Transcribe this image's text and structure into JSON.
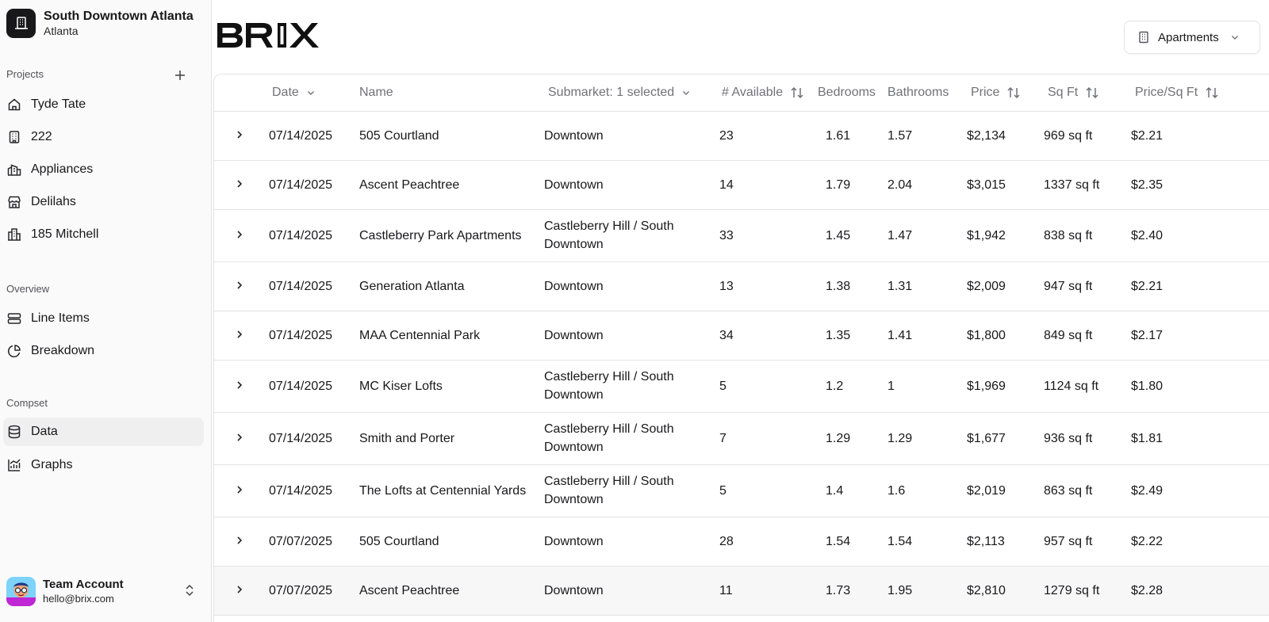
{
  "workspace": {
    "title": "South Downtown Atlanta",
    "subtitle": "Atlanta"
  },
  "sidebar": {
    "projects_label": "Projects",
    "projects": [
      {
        "label": "Tyde Tate",
        "icon": "home-icon"
      },
      {
        "label": "222",
        "icon": "building-icon"
      },
      {
        "label": "Appliances",
        "icon": "buildings-icon"
      },
      {
        "label": "Delilahs",
        "icon": "store-icon"
      },
      {
        "label": "185 Mitchell",
        "icon": "city-icon"
      }
    ],
    "overview_label": "Overview",
    "overview": [
      {
        "label": "Line Items",
        "icon": "layers-icon"
      },
      {
        "label": "Breakdown",
        "icon": "pie-chart-icon"
      }
    ],
    "compset_label": "Compset",
    "compset": [
      {
        "label": "Data",
        "icon": "database-icon",
        "active": true
      },
      {
        "label": "Graphs",
        "icon": "chart-icon"
      }
    ]
  },
  "account": {
    "name": "Team Account",
    "email": "hello@brix.com"
  },
  "header": {
    "property_type": "Apartments"
  },
  "table": {
    "columns": {
      "date": "Date",
      "name": "Name",
      "submarket": "Submarket: 1 selected",
      "available": "# Available",
      "bedrooms": "Bedrooms",
      "bathrooms": "Bathrooms",
      "price": "Price",
      "sqft": "Sq Ft",
      "price_sqft": "Price/Sq Ft"
    },
    "rows": [
      {
        "date": "07/14/2025",
        "name": "505 Courtland",
        "submarket": "Downtown",
        "available": "23",
        "bedrooms": "1.61",
        "bathrooms": "1.57",
        "price": "$2,134",
        "sqft": "969 sq ft",
        "price_sqft": "$2.21"
      },
      {
        "date": "07/14/2025",
        "name": "Ascent Peachtree",
        "submarket": "Downtown",
        "available": "14",
        "bedrooms": "1.79",
        "bathrooms": "2.04",
        "price": "$3,015",
        "sqft": "1337 sq ft",
        "price_sqft": "$2.35"
      },
      {
        "date": "07/14/2025",
        "name": "Castleberry Park Apartments",
        "submarket": "Castleberry Hill / South Downtown",
        "available": "33",
        "bedrooms": "1.45",
        "bathrooms": "1.47",
        "price": "$1,942",
        "sqft": "838 sq ft",
        "price_sqft": "$2.40"
      },
      {
        "date": "07/14/2025",
        "name": "Generation Atlanta",
        "submarket": "Downtown",
        "available": "13",
        "bedrooms": "1.38",
        "bathrooms": "1.31",
        "price": "$2,009",
        "sqft": "947 sq ft",
        "price_sqft": "$2.21"
      },
      {
        "date": "07/14/2025",
        "name": "MAA Centennial Park",
        "submarket": "Downtown",
        "available": "34",
        "bedrooms": "1.35",
        "bathrooms": "1.41",
        "price": "$1,800",
        "sqft": "849 sq ft",
        "price_sqft": "$2.17"
      },
      {
        "date": "07/14/2025",
        "name": "MC Kiser Lofts",
        "submarket": "Castleberry Hill / South Downtown",
        "available": "5",
        "bedrooms": "1.2",
        "bathrooms": "1",
        "price": "$1,969",
        "sqft": "1124 sq ft",
        "price_sqft": "$1.80"
      },
      {
        "date": "07/14/2025",
        "name": "Smith and Porter",
        "submarket": "Castleberry Hill / South Downtown",
        "available": "7",
        "bedrooms": "1.29",
        "bathrooms": "1.29",
        "price": "$1,677",
        "sqft": "936 sq ft",
        "price_sqft": "$1.81"
      },
      {
        "date": "07/14/2025",
        "name": "The Lofts at Centennial Yards",
        "submarket": "Castleberry Hill / South Downtown",
        "available": "5",
        "bedrooms": "1.4",
        "bathrooms": "1.6",
        "price": "$2,019",
        "sqft": "863 sq ft",
        "price_sqft": "$2.49"
      },
      {
        "date": "07/07/2025",
        "name": "505 Courtland",
        "submarket": "Downtown",
        "available": "28",
        "bedrooms": "1.54",
        "bathrooms": "1.54",
        "price": "$2,113",
        "sqft": "957 sq ft",
        "price_sqft": "$2.22"
      },
      {
        "date": "07/07/2025",
        "name": "Ascent Peachtree",
        "submarket": "Downtown",
        "available": "11",
        "bedrooms": "1.73",
        "bathrooms": "1.95",
        "price": "$2,810",
        "sqft": "1279 sq ft",
        "price_sqft": "$2.28"
      }
    ]
  }
}
